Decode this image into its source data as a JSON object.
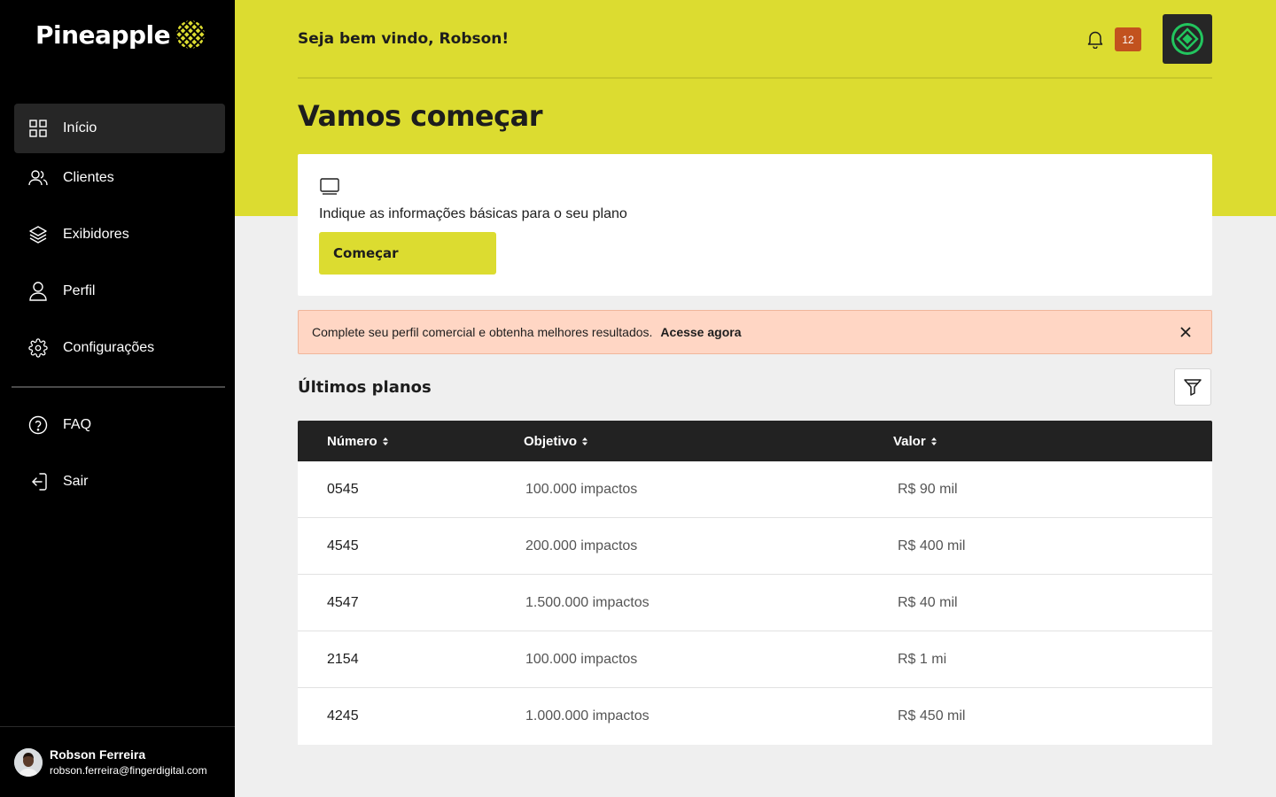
{
  "app": {
    "name": "Pineapple"
  },
  "sidebar": {
    "items": [
      {
        "label": "Início",
        "icon": "grid-icon",
        "active": true
      },
      {
        "label": "Clientes",
        "icon": "users-icon"
      },
      {
        "label": "Exibidores",
        "icon": "layers-icon"
      },
      {
        "label": "Perfil",
        "icon": "user-icon"
      },
      {
        "label": "Configurações",
        "icon": "gear-icon"
      }
    ],
    "secondary": [
      {
        "label": "FAQ",
        "icon": "help-circle-icon"
      },
      {
        "label": "Sair",
        "icon": "logout-icon"
      }
    ],
    "user": {
      "name": "Robson Ferreira",
      "email": "robson.ferreira@fingerdigital.com"
    }
  },
  "header": {
    "welcome": "Seja bem vindo, Robson!",
    "notification_count": "12",
    "page_title": "Vamos começar"
  },
  "card": {
    "text": "Indique as informações básicas para o seu plano",
    "button_label": "Começar"
  },
  "alert": {
    "text": "Complete seu perfil comercial e obtenha melhores resultados.",
    "link": "Acesse agora"
  },
  "plans": {
    "title": "Últimos planos",
    "columns": [
      "Número",
      "Objetivo",
      "Valor"
    ],
    "rows": [
      [
        "0545",
        "100.000 impactos",
        "R$ 90 mil"
      ],
      [
        "4545",
        "200.000 impactos",
        "R$ 400 mil"
      ],
      [
        "4547",
        "1.500.000 impactos",
        "R$ 40 mil"
      ],
      [
        "2154",
        "100.000 impactos",
        "R$ 1 mi"
      ],
      [
        "4245",
        "1.000.000 impactos",
        "R$ 450 mil"
      ]
    ]
  },
  "colors": {
    "accent": "#dcdc30",
    "sidebar": "#000000",
    "badge": "#c2521e",
    "alert_bg": "#ffd6c4"
  }
}
